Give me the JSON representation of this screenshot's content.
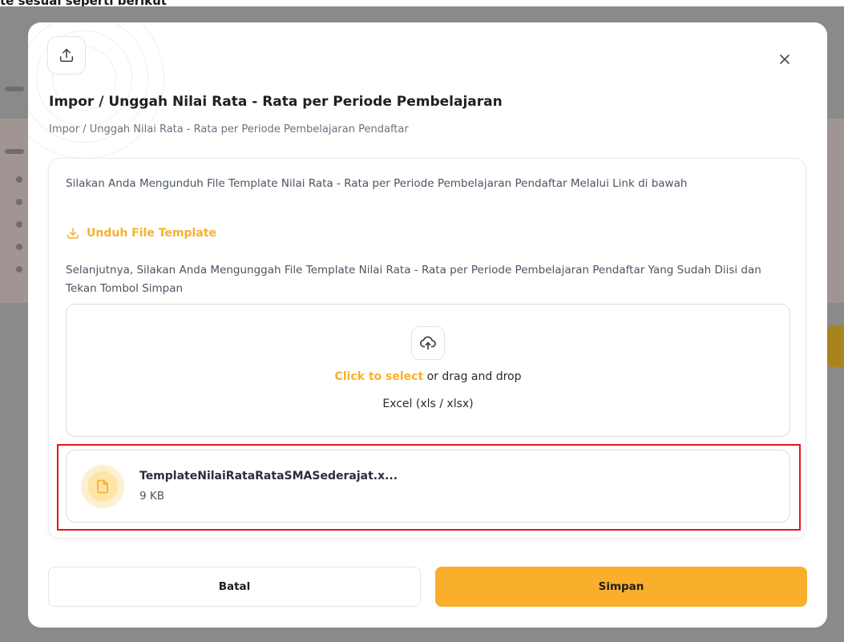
{
  "background": {
    "top_snippet": "te sesuai seperti berikut"
  },
  "modal": {
    "header_icon": "upload-icon",
    "close_icon": "close-icon",
    "close_glyph": "×",
    "title": "Impor / Unggah Nilai Rata - Rata per Periode Pembelajaran",
    "subtitle": "Impor / Unggah Nilai Rata - Rata per Periode Pembelajaran Pendaftar",
    "instructions": {
      "download_text": "Silakan Anda Mengunduh File Template Nilai Rata - Rata per Periode Pembelajaran Pendaftar Melalui Link di bawah",
      "download_link_label": "Unduh File Template",
      "download_icon": "download-icon",
      "upload_text": "Selanjutnya, Silakan Anda Mengunggah File Template Nilai Rata - Rata per Periode Pembelajaran Pendaftar Yang Sudah Diisi dan Tekan Tombol Simpan"
    },
    "dropzone": {
      "icon": "cloud-upload-icon",
      "click_label": "Click to select",
      "drag_text": " or drag and drop",
      "accepted_formats": "Excel (xls / xlsx)"
    },
    "uploaded_file": {
      "icon": "file-icon",
      "name": "TemplateNilaiRataRataSMASederajat.x...",
      "size": "9 KB"
    },
    "buttons": {
      "cancel_label": "Batal",
      "save_label": "Simpan"
    }
  },
  "colors": {
    "accent": "#f9af2c",
    "accent_light_outer": "#fdf0d0",
    "accent_light_inner": "#fde5a8",
    "highlight": "#e3141b",
    "backdrop": "#8a8a8a"
  }
}
